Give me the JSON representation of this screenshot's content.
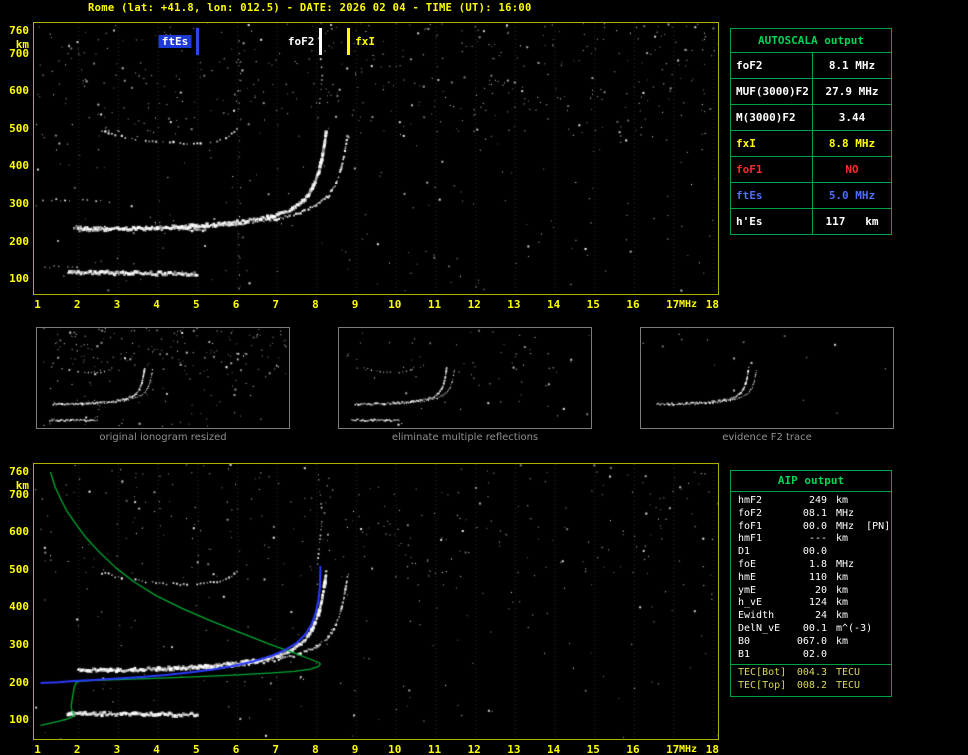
{
  "title": "Rome (lat: +41.8, lon: 012.5) - DATE: 2026 02 04 - TIME (UT): 16:00",
  "autoscala_table": {
    "header": "AUTOSCALA output",
    "rows": [
      {
        "label": "foF2",
        "value": "8.1 MHz",
        "color": "#ffffff"
      },
      {
        "label": "MUF(3000)F2",
        "value": "27.9 MHz",
        "color": "#ffffff"
      },
      {
        "label": "M(3000)F2",
        "value": "3.44",
        "color": "#ffffff"
      },
      {
        "label": "fxI",
        "value": "8.8 MHz",
        "color": "#ffff00"
      },
      {
        "label": "foF1",
        "value": "NO",
        "color": "#ff2a2a"
      },
      {
        "label": "ftEs",
        "value": "5.0 MHz",
        "color": "#4d6dff"
      },
      {
        "label": "h'Es",
        "value": "117   km",
        "color": "#ffffff"
      }
    ]
  },
  "aip_table": {
    "header": "AIP output",
    "rows": [
      {
        "name": "hmF2",
        "value": "249",
        "unit": "km"
      },
      {
        "name": "foF2",
        "value": "08.1",
        "unit": "MHz"
      },
      {
        "name": "foF1",
        "value": "00.0",
        "unit": "MHz  [PN]"
      },
      {
        "name": "hmF1",
        "value": "---",
        "unit": "km"
      },
      {
        "name": "D1",
        "value": "00.0",
        "unit": ""
      },
      {
        "name": "foE",
        "value": "1.8",
        "unit": "MHz"
      },
      {
        "name": "hmE",
        "value": "110",
        "unit": "km"
      },
      {
        "name": "ymE",
        "value": "20",
        "unit": "km"
      },
      {
        "name": "h_vE",
        "value": "124",
        "unit": "km"
      },
      {
        "name": "Ewidth",
        "value": "24",
        "unit": "km"
      },
      {
        "name": "DelN_vE",
        "value": "00.1",
        "unit": "m^(-3)"
      },
      {
        "name": "B0",
        "value": "067.0",
        "unit": "km"
      },
      {
        "name": "B1",
        "value": "02.0",
        "unit": ""
      }
    ],
    "tec_rows": [
      {
        "name": "TEC[Bot]",
        "value": "004.3",
        "unit": "TECU"
      },
      {
        "name": "TEC[Top]",
        "value": "008.2",
        "unit": "TECU"
      }
    ]
  },
  "thumbnails": [
    {
      "caption": "original ionogram resized"
    },
    {
      "caption": "eliminate multiple reflections"
    },
    {
      "caption": "evidence F2 trace"
    }
  ],
  "chart_data": {
    "type": "scatter",
    "title": "ionogram: virtual height (km) vs sounding frequency (MHz)",
    "x_unit": "MHz",
    "y_unit": "km",
    "xlim": [
      1,
      18
    ],
    "ylim": [
      60,
      760
    ],
    "x_ticks": [
      1,
      2,
      3,
      4,
      5,
      6,
      7,
      8,
      9,
      10,
      11,
      12,
      13,
      14,
      15,
      16,
      17,
      18
    ],
    "y_ticks": [
      760,
      700,
      600,
      500,
      400,
      300,
      200,
      100
    ],
    "markers": [
      {
        "label": "ftEs",
        "freq": 5.0,
        "text_color": "#ffffff",
        "bg_color": "#1f3bd6",
        "line_color": "#2a48e8",
        "side": "left"
      },
      {
        "label": "foF2",
        "freq": 8.1,
        "text_color": "#ffffff",
        "bg_color": "",
        "line_color": "#ffffff",
        "side": "left"
      },
      {
        "label": "fxI",
        "freq": 8.8,
        "text_color": "#ffff00",
        "bg_color": "",
        "line_color": "#ffff00",
        "side": "right"
      }
    ],
    "scaled_values": {
      "foF2_MHz": 8.1,
      "MUF3000F2_MHz": 27.9,
      "M3000F2": 3.44,
      "fxI_MHz": 8.8,
      "ftEs_MHz": 5.0,
      "hEs_km": 117,
      "hmF2_km": 249
    },
    "traces": {
      "es": {
        "style": "thick",
        "points": [
          [
            1.75,
            118
          ],
          [
            3.2,
            116
          ],
          [
            5.0,
            114
          ]
        ]
      },
      "es_hop2": {
        "style": "medium",
        "points": [
          [
            1.9,
            238
          ],
          [
            3.5,
            234
          ],
          [
            5.2,
            231
          ]
        ]
      },
      "f2_o": {
        "style": "thick",
        "points": [
          [
            2.0,
            231
          ],
          [
            3.0,
            233
          ],
          [
            4.0,
            236
          ],
          [
            5.0,
            241
          ],
          [
            5.8,
            248
          ],
          [
            6.5,
            258
          ],
          [
            7.0,
            270
          ],
          [
            7.4,
            287
          ],
          [
            7.7,
            310
          ],
          [
            7.9,
            340
          ],
          [
            8.05,
            380
          ],
          [
            8.15,
            425
          ],
          [
            8.22,
            470
          ],
          [
            8.25,
            492
          ]
        ]
      },
      "f2_x": {
        "style": "medium",
        "points": [
          [
            4.6,
            235
          ],
          [
            5.5,
            241
          ],
          [
            6.3,
            249
          ],
          [
            7.0,
            260
          ],
          [
            7.6,
            276
          ],
          [
            8.0,
            295
          ],
          [
            8.3,
            320
          ],
          [
            8.5,
            355
          ],
          [
            8.63,
            395
          ],
          [
            8.72,
            440
          ],
          [
            8.78,
            478
          ]
        ]
      },
      "f2_hop2": {
        "style": "dotted",
        "points": [
          [
            2.6,
            492
          ],
          [
            3.1,
            478
          ],
          [
            3.7,
            468
          ],
          [
            4.4,
            462
          ],
          [
            5.0,
            461
          ],
          [
            5.5,
            466
          ],
          [
            5.8,
            478
          ],
          [
            6.0,
            497
          ]
        ]
      },
      "f2_spread": {
        "style": "sparse",
        "points": [
          [
            8.02,
            505
          ],
          [
            8.08,
            570
          ],
          [
            8.15,
            640
          ],
          [
            8.1,
            700
          ],
          [
            8.05,
            752
          ]
        ]
      },
      "noise_row_a": {
        "style": "sparse",
        "points": [
          [
            1.0,
            312
          ],
          [
            2.9,
            307
          ]
        ]
      },
      "noise_row_b": {
        "style": "sparse",
        "points": [
          [
            1.05,
            133
          ],
          [
            2.2,
            130
          ]
        ]
      }
    },
    "profile_green": {
      "color": "#00aa33",
      "points": [
        [
          1.3,
          760
        ],
        [
          1.42,
          720
        ],
        [
          1.55,
          690
        ],
        [
          1.72,
          655
        ],
        [
          1.95,
          620
        ],
        [
          2.2,
          585
        ],
        [
          2.55,
          545
        ],
        [
          2.95,
          505
        ],
        [
          3.4,
          468
        ],
        [
          3.95,
          432
        ],
        [
          4.6,
          398
        ],
        [
          5.3,
          366
        ],
        [
          6.05,
          334
        ],
        [
          6.8,
          303
        ],
        [
          7.45,
          278
        ],
        [
          7.9,
          260
        ],
        [
          8.08,
          252
        ],
        [
          8.1,
          249
        ],
        [
          8.05,
          243
        ],
        [
          7.85,
          236
        ],
        [
          7.45,
          230
        ],
        [
          6.8,
          225
        ],
        [
          5.9,
          220
        ],
        [
          4.9,
          215
        ],
        [
          3.9,
          211
        ],
        [
          3.0,
          208
        ],
        [
          2.4,
          206
        ],
        [
          2.05,
          204
        ],
        [
          1.95,
          200
        ],
        [
          1.9,
          188
        ],
        [
          1.87,
          170
        ],
        [
          1.84,
          150
        ],
        [
          1.82,
          134
        ],
        [
          1.86,
          122
        ],
        [
          1.9,
          115
        ],
        [
          1.88,
          110
        ],
        [
          1.75,
          104
        ],
        [
          1.5,
          97
        ],
        [
          1.25,
          91
        ],
        [
          1.05,
          86
        ]
      ]
    },
    "model_blue": {
      "color": "#2a3bff",
      "points": [
        [
          1.05,
          199
        ],
        [
          1.5,
          201
        ],
        [
          1.9,
          204
        ],
        [
          2.4,
          207
        ],
        [
          3.0,
          211
        ],
        [
          3.6,
          215
        ],
        [
          4.2,
          220
        ],
        [
          4.8,
          227
        ],
        [
          5.4,
          235
        ],
        [
          5.9,
          244
        ],
        [
          6.4,
          256
        ],
        [
          6.85,
          270
        ],
        [
          7.2,
          286
        ],
        [
          7.5,
          305
        ],
        [
          7.72,
          328
        ],
        [
          7.88,
          355
        ],
        [
          7.98,
          385
        ],
        [
          8.05,
          418
        ],
        [
          8.09,
          455
        ],
        [
          8.1,
          495
        ],
        [
          8.1,
          510
        ]
      ]
    },
    "panels": {
      "top": {
        "traces": [
          "es",
          "es_hop2",
          "f2_o",
          "f2_x",
          "f2_hop2",
          "f2_spread",
          "noise_row_a",
          "noise_row_b"
        ],
        "noise": 650,
        "top_bias": 0.55,
        "columns": [
          6.05
        ],
        "seed": 7,
        "grid": true
      },
      "bottom": {
        "traces": [
          "es",
          "f2_o",
          "f2_x",
          "f2_hop2",
          "f2_spread"
        ],
        "noise": 430,
        "top_bias": 0.45,
        "columns": [],
        "seed": 21,
        "grid": true,
        "profile": true,
        "model": true
      },
      "thumbs": [
        {
          "traces": [
            "es",
            "es_hop2",
            "f2_o",
            "f2_x",
            "f2_hop2"
          ],
          "noise": 240,
          "top_bias": 0.5,
          "columns": [],
          "seed": 5
        },
        {
          "traces": [
            "es",
            "f2_o",
            "f2_x",
            "f2_hop2"
          ],
          "noise": 70,
          "top_bias": 0.4,
          "columns": [],
          "seed": 9
        },
        {
          "traces": [
            "f2_o",
            "f2_x"
          ],
          "noise": 16,
          "top_bias": 0.3,
          "columns": [],
          "seed": 13
        }
      ]
    }
  }
}
